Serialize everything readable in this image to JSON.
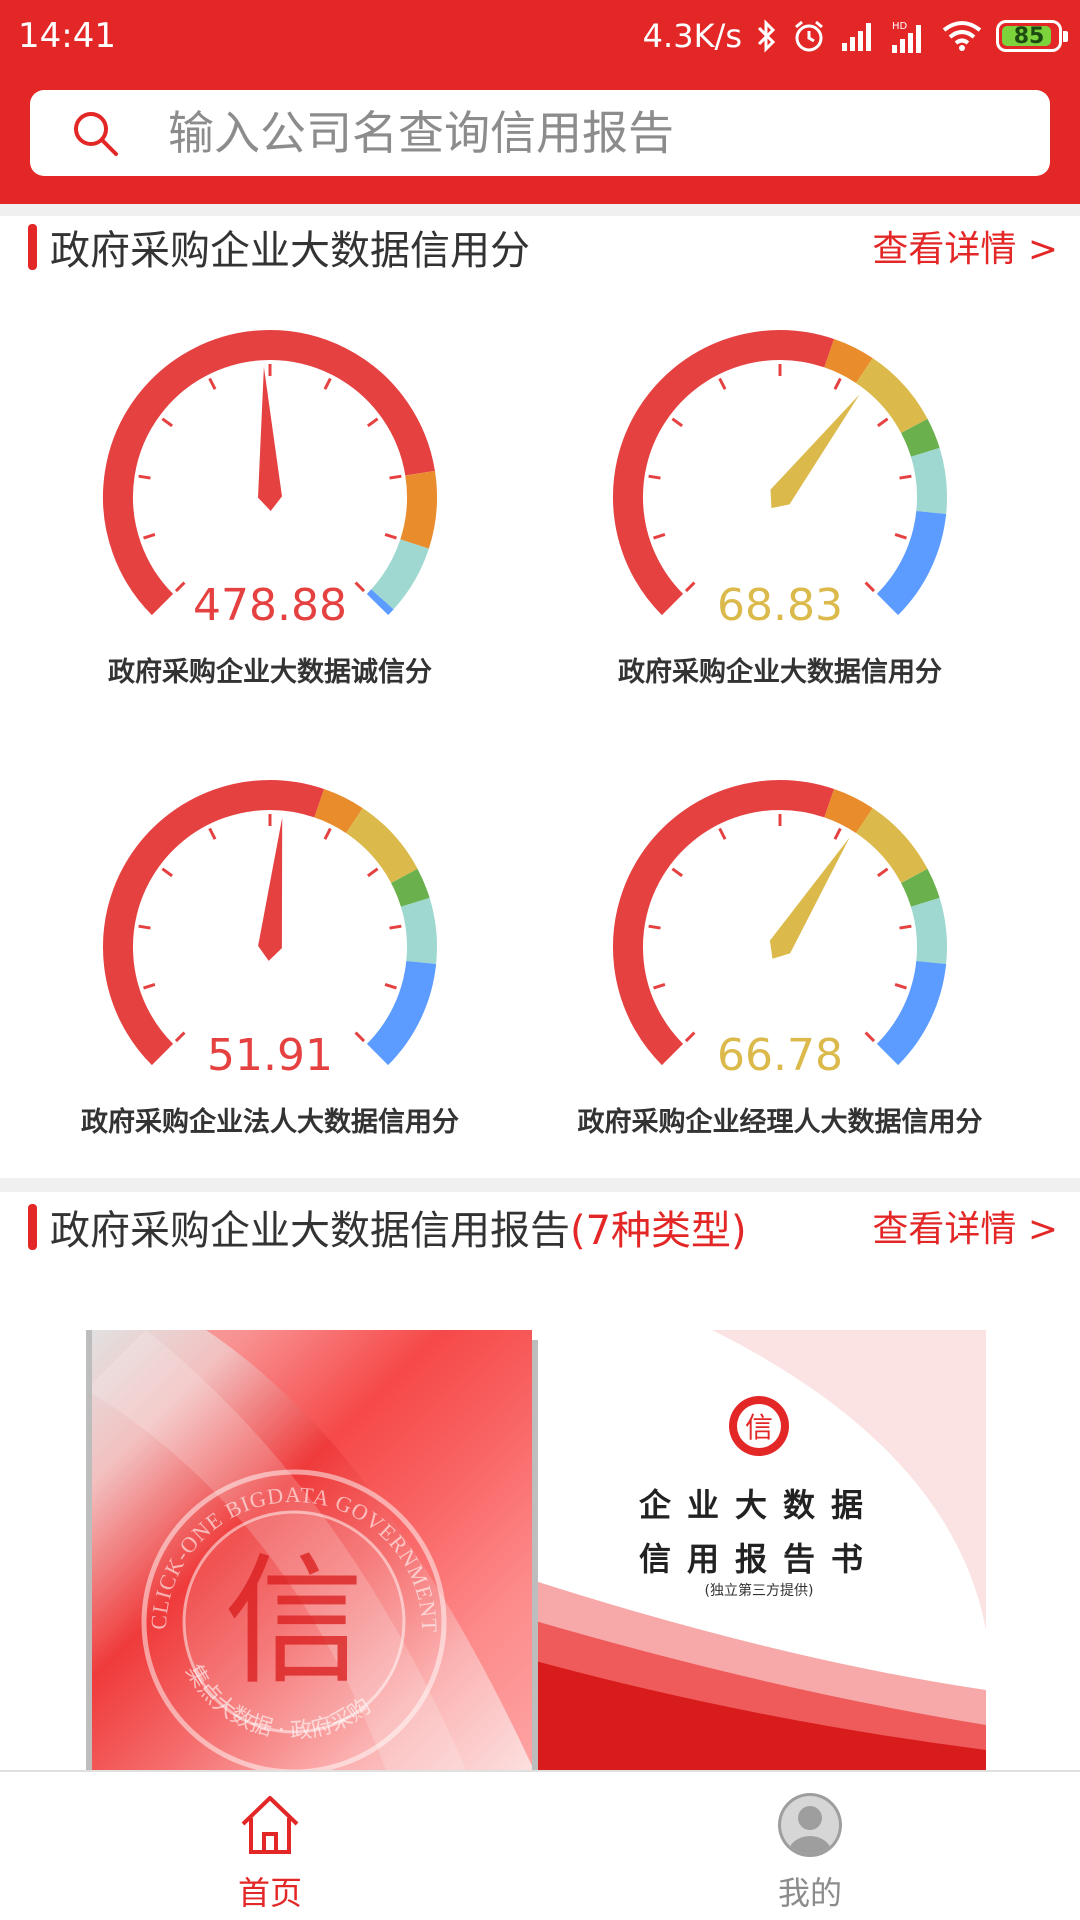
{
  "status_bar": {
    "time": "14:41",
    "net_speed": "4.3K/s",
    "battery": "85",
    "icons": [
      "bluetooth-icon",
      "alarm-icon",
      "signal-icon",
      "hd-signal-icon",
      "wifi-icon",
      "battery-icon"
    ]
  },
  "search": {
    "placeholder": "输入公司名查询信用报告",
    "icon": "search-icon"
  },
  "colors": {
    "brand_red": "#e32727",
    "gauge_red": "#e54141",
    "gauge_orange": "#e98c2c",
    "gauge_yellow": "#dbb94a",
    "gauge_green": "#6ab04c",
    "gauge_teal": "#9ed8d0",
    "gauge_blue": "#5c9bff"
  },
  "section1": {
    "title": "政府采购企业大数据信用分",
    "more": "查看详情 >"
  },
  "gauges": [
    {
      "value": "478.88",
      "label": "政府采购企业大数据诚信分",
      "level": 0.49,
      "value_color": "#e54141",
      "needle_color": "#e54141",
      "scheme": "a"
    },
    {
      "value": "68.83",
      "label": "政府采购企业大数据信用分",
      "level": 0.64,
      "value_color": "#dbb94a",
      "needle_color": "#dbb94a",
      "scheme": "b"
    },
    {
      "value": "51.91",
      "label": "政府采购企业法人大数据信用分",
      "level": 0.52,
      "value_color": "#e54141",
      "needle_color": "#e54141",
      "scheme": "b"
    },
    {
      "value": "66.78",
      "label": "政府采购企业经理人大数据信用分",
      "level": 0.62,
      "value_color": "#dbb94a",
      "needle_color": "#dbb94a",
      "scheme": "b"
    }
  ],
  "section2": {
    "title": "政府采购企业大数据信用报告",
    "highlight": "(7种类型)",
    "more": "查看详情 >"
  },
  "report_cover": {
    "seal_text_top": "CLICK-ONE BIGDATA GOVERNMENT PROCUREMENT",
    "seal_text_bottom": "集点大数据 · 政府采购",
    "seal_char": "信",
    "title_line1": "企业大数据",
    "title_line2": "信用报告书",
    "subtitle": "(独立第三方提供)"
  },
  "tabbar": {
    "tabs": [
      {
        "label": "首页",
        "icon": "home-icon",
        "active": true
      },
      {
        "label": "我的",
        "icon": "profile-icon",
        "active": false
      }
    ]
  }
}
